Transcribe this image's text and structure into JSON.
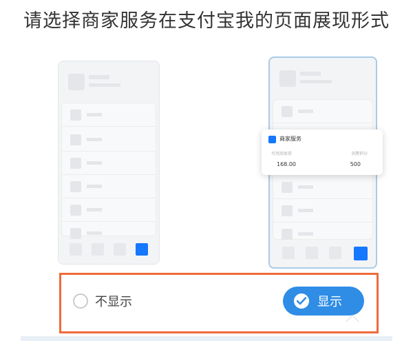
{
  "title": "请选择商家服务在支付宝我的页面展现形式",
  "card": {
    "title": "商家服务",
    "label_left": "可用商家券",
    "label_right": "消费积分",
    "value_left": "168.00",
    "value_right": "500"
  },
  "options": {
    "hide_label": "不显示",
    "show_label": "显示",
    "selected": "显示"
  },
  "colors": {
    "accent": "#2f8de6",
    "highlight_border": "#ef6a3a",
    "tab_active": "#1677ff"
  }
}
